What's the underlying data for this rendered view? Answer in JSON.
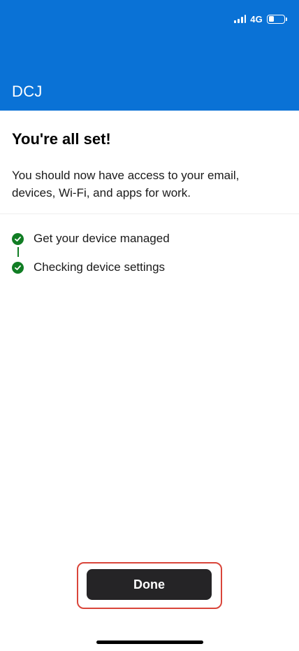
{
  "status_bar": {
    "network": "4G",
    "battery_level": 0.35,
    "signal_bars": 4
  },
  "header": {
    "title": "DCJ",
    "background_color": "#0A72D6"
  },
  "main": {
    "title": "You're all set!",
    "description": "You should now have access to your email, devices, Wi-Fi, and apps for work."
  },
  "steps": [
    {
      "label": "Get your device managed",
      "status": "complete",
      "icon": "check-circle-icon"
    },
    {
      "label": "Checking device settings",
      "status": "complete",
      "icon": "check-circle-icon"
    }
  ],
  "colors": {
    "success": "#117D24",
    "button_bg": "#252426",
    "highlight": "#D9453A"
  },
  "footer": {
    "done_label": "Done"
  }
}
